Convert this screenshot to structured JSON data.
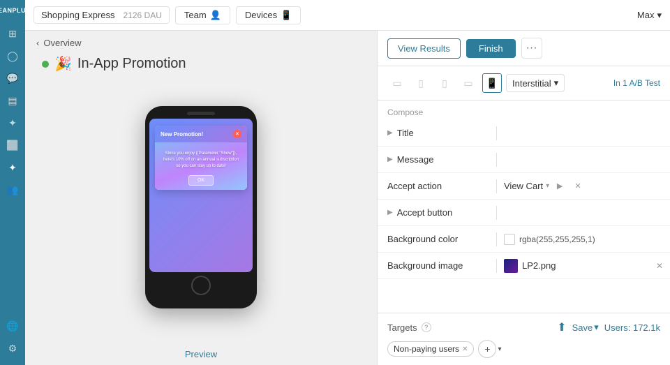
{
  "topbar": {
    "logo": "LEANPLUM",
    "app_name": "Shopping Express",
    "dau": "2126 DAU",
    "team_btn": "Team",
    "devices_btn": "Devices",
    "user": "Max"
  },
  "sidebar": {
    "icons": [
      {
        "name": "home-icon",
        "symbol": "⊞",
        "active": false
      },
      {
        "name": "user-icon",
        "symbol": "👤",
        "active": false
      },
      {
        "name": "chat-icon",
        "symbol": "💬",
        "active": false
      },
      {
        "name": "chart-icon",
        "symbol": "📊",
        "active": false
      },
      {
        "name": "tools-icon",
        "symbol": "✦",
        "active": false
      },
      {
        "name": "box-icon",
        "symbol": "◻",
        "active": false
      },
      {
        "name": "sparkle-icon",
        "symbol": "✦",
        "active": false
      },
      {
        "name": "people-icon",
        "symbol": "👥",
        "active": false
      },
      {
        "name": "globe-icon",
        "symbol": "🌐",
        "active": false
      }
    ]
  },
  "preview": {
    "breadcrumb_back": "Overview",
    "campaign_title": "In-App Promotion",
    "status": "live",
    "modal_title": "New Promotion!",
    "modal_body": "Since you enjoy {{Parameter \"Show\"}}, here's 10% off on an annual subscription so you can stay up to date!",
    "modal_ok": "OK",
    "preview_link": "Preview"
  },
  "right_panel": {
    "view_results_btn": "View Results",
    "finish_btn": "Finish",
    "more_btn": "···",
    "device_types": [
      "tablet-landscape",
      "tablet-portrait",
      "tablet-small",
      "phone-landscape",
      "phone-portrait"
    ],
    "interstitial_label": "Interstitial",
    "ab_test_label": "In 1 A/B Test",
    "compose_label": "Compose",
    "fields": [
      {
        "label": "Title",
        "value": "",
        "expandable": true
      },
      {
        "label": "Message",
        "value": "",
        "expandable": true
      },
      {
        "label": "Accept action",
        "value": "View Cart",
        "expandable": false,
        "has_actions": true
      },
      {
        "label": "Accept button",
        "value": "",
        "expandable": true
      },
      {
        "label": "Background color",
        "value": "rgba(255,255,255,1)",
        "expandable": false,
        "has_color": true
      },
      {
        "label": "Background image",
        "value": "LP2.png",
        "expandable": false,
        "has_image": true
      }
    ],
    "targets_label": "Targets",
    "targets_help": "?",
    "save_btn": "Save",
    "users_count": "Users: 172.1k",
    "chips": [
      {
        "label": "Non-paying users"
      }
    ],
    "add_target_btn": "+"
  }
}
